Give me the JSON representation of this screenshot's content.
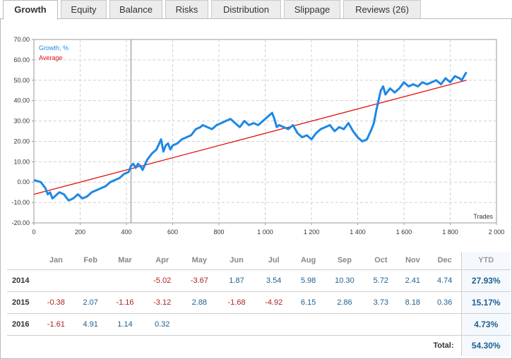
{
  "tabs": [
    {
      "label": "Growth",
      "active": true
    },
    {
      "label": "Equity"
    },
    {
      "label": "Balance"
    },
    {
      "label": "Risks"
    },
    {
      "label": "Distribution"
    },
    {
      "label": "Slippage"
    },
    {
      "label": "Reviews (26)"
    }
  ],
  "colors": {
    "growth": "#1e88e5",
    "average": "#e01010",
    "positive": "#1e5f8e",
    "negative": "#b02020"
  },
  "chart_data": {
    "type": "line",
    "legend": [
      "Growth, %",
      "Average"
    ],
    "xlabel": "Trades",
    "xlim": [
      0,
      2000
    ],
    "ylim": [
      -20,
      70
    ],
    "x_ticks": [
      "0",
      "200",
      "400",
      "600",
      "800",
      "1 000",
      "1 200",
      "1 400",
      "1 600",
      "1 800",
      "2 000"
    ],
    "y_ticks": [
      "70.00",
      "60.00",
      "50.00",
      "40.00",
      "30.00",
      "20.00",
      "10.00",
      "0.00",
      "-10.00",
      "-20.00"
    ],
    "marker_x": 420,
    "series": [
      {
        "name": "Growth, %",
        "x": [
          0,
          30,
          50,
          60,
          70,
          80,
          90,
          100,
          110,
          130,
          150,
          170,
          190,
          210,
          230,
          250,
          270,
          290,
          310,
          330,
          350,
          370,
          390,
          410,
          420,
          430,
          440,
          450,
          460,
          470,
          490,
          510,
          530,
          550,
          560,
          570,
          580,
          590,
          600,
          620,
          640,
          660,
          680,
          700,
          720,
          730,
          750,
          770,
          790,
          810,
          830,
          850,
          870,
          890,
          910,
          930,
          950,
          970,
          990,
          1010,
          1030,
          1040,
          1050,
          1060,
          1080,
          1100,
          1120,
          1140,
          1160,
          1180,
          1200,
          1220,
          1240,
          1260,
          1280,
          1300,
          1320,
          1340,
          1360,
          1380,
          1400,
          1420,
          1440,
          1460,
          1470,
          1480,
          1500,
          1510,
          1520,
          1540,
          1560,
          1580,
          1600,
          1620,
          1640,
          1660,
          1680,
          1700,
          1720,
          1740,
          1760,
          1780,
          1800,
          1820,
          1840,
          1850,
          1860,
          1870
        ],
        "y": [
          1,
          0,
          -3,
          -6,
          -5,
          -8,
          -7,
          -6,
          -5,
          -6,
          -9,
          -8,
          -6,
          -8,
          -7,
          -5,
          -4,
          -3,
          -2,
          0,
          1,
          2,
          4,
          5,
          8,
          9,
          7,
          9,
          8,
          6,
          11,
          14,
          16,
          21,
          15,
          18,
          19,
          16,
          18,
          19,
          21,
          22,
          23,
          26,
          27,
          28,
          27,
          26,
          28,
          29,
          30,
          31,
          29,
          27,
          30,
          28,
          29,
          28,
          30,
          32,
          34,
          31,
          27,
          28,
          27,
          26,
          28,
          24,
          22,
          23,
          21,
          24,
          26,
          27,
          28,
          25,
          27,
          26,
          29,
          25,
          22,
          20,
          21,
          26,
          29,
          35,
          45,
          47,
          43,
          46,
          44,
          46,
          49,
          47,
          48,
          47,
          49,
          48,
          49,
          50,
          48,
          51,
          49,
          52,
          51,
          50,
          52,
          54
        ]
      },
      {
        "name": "Average",
        "x": [
          0,
          1870
        ],
        "y": [
          -6,
          50
        ]
      }
    ]
  },
  "monthly_table": {
    "months": [
      "Jan",
      "Feb",
      "Mar",
      "Apr",
      "May",
      "Jun",
      "Jul",
      "Aug",
      "Sep",
      "Oct",
      "Nov",
      "Dec"
    ],
    "ytd_header": "YTD",
    "rows": [
      {
        "year": "2014",
        "values": [
          "",
          "",
          "",
          "-5.02",
          "-3.67",
          "1.87",
          "3.54",
          "5.98",
          "10.30",
          "5.72",
          "2.41",
          "4.74"
        ],
        "ytd": "27.93%"
      },
      {
        "year": "2015",
        "values": [
          "-0.38",
          "2.07",
          "-1.16",
          "-3.12",
          "2.88",
          "-1.68",
          "-4.92",
          "6.15",
          "2.86",
          "3.73",
          "8.18",
          "0.36"
        ],
        "ytd": "15.17%"
      },
      {
        "year": "2016",
        "values": [
          "-1.61",
          "4.91",
          "1.14",
          "0.32",
          "",
          "",
          "",
          "",
          "",
          "",
          "",
          ""
        ],
        "ytd": "4.73%"
      }
    ],
    "total_label": "Total:",
    "total_value": "54.30%"
  }
}
